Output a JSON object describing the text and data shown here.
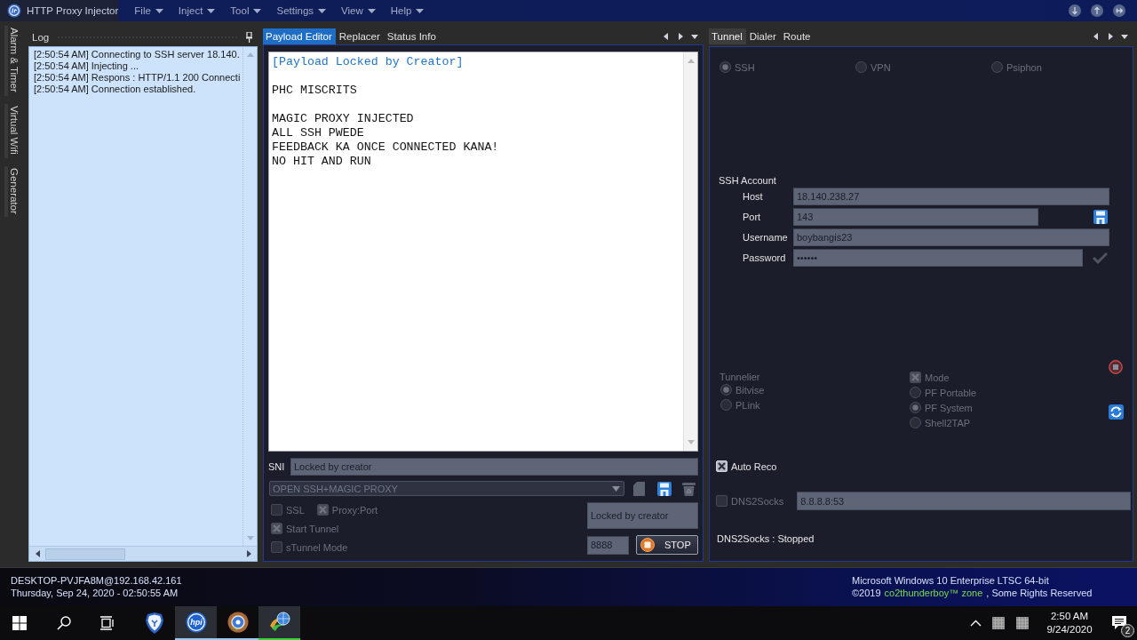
{
  "window": {
    "title": "HTTP Proxy Injector"
  },
  "menu": [
    {
      "label": "File"
    },
    {
      "label": "Inject"
    },
    {
      "label": "Tool"
    },
    {
      "label": "Settings"
    },
    {
      "label": "View"
    },
    {
      "label": "Help"
    }
  ],
  "side_tabs": [
    {
      "label": "Alarm & Timer"
    },
    {
      "label": "Virtual Wifi"
    },
    {
      "label": "Generator"
    }
  ],
  "log": {
    "title": "Log",
    "lines": [
      "[2:50:54 AM] Connecting to SSH server 18.140.",
      "[2:50:54 AM] Injecting ...",
      "[2:50:54 AM] Respons : HTTP/1.1 200 Connecti",
      "[2:50:54 AM] Connection established."
    ]
  },
  "payload_panel": {
    "tabs": [
      {
        "label": "Payload Editor",
        "selected": true
      },
      {
        "label": "Replacer",
        "selected": false
      },
      {
        "label": "Status Info",
        "selected": false
      }
    ],
    "editor": {
      "paragraphs": [
        {
          "kind": "notice",
          "lines": [
            "[Payload Locked by Creator]"
          ]
        },
        {
          "kind": "plain",
          "lines": [
            "PHC MISCRITS"
          ]
        },
        {
          "kind": "plain",
          "lines": [
            "MAGIC PROXY INJECTED",
            "ALL SSH PWEDE",
            "FEEDBACK KA ONCE CONNECTED KANA!",
            "NO HIT AND RUN"
          ]
        }
      ]
    },
    "sni": {
      "label": "SNI",
      "value": "Locked by creator"
    },
    "profile": {
      "value": "OPEN SSH+MAGIC PROXY",
      "disabled": true
    },
    "option_rows": [
      [
        {
          "label": "SSL",
          "checked": false,
          "disabled": true
        },
        {
          "label": "Proxy:Port",
          "checked": true,
          "disabled": true
        }
      ],
      [
        {
          "label": "Start Tunnel",
          "checked": true,
          "disabled": true
        }
      ],
      [
        {
          "label": "sTunnel Mode",
          "checked": false,
          "disabled": true
        }
      ]
    ],
    "proxy": {
      "value": "Locked by creator"
    },
    "port": {
      "value": "8888"
    },
    "stop_button": {
      "label": "STOP"
    }
  },
  "tunnel_panel": {
    "tabs": [
      {
        "label": "Tunnel",
        "selected": true
      },
      {
        "label": "Dialer",
        "selected": false
      },
      {
        "label": "Route",
        "selected": false
      }
    ],
    "protocols": [
      {
        "label": "SSH",
        "selected": true,
        "disabled": true
      },
      {
        "label": "VPN",
        "selected": false,
        "disabled": true
      },
      {
        "label": "Psiphon",
        "selected": false,
        "disabled": true
      }
    ],
    "ssh_account": {
      "title": "SSH Account",
      "fields": [
        {
          "kind": "text",
          "label": "Host",
          "value": "18.140.238.27"
        },
        {
          "kind": "port",
          "label": "Port",
          "value": "143"
        },
        {
          "kind": "text",
          "label": "Username",
          "value": "boybangis23"
        },
        {
          "kind": "password",
          "label": "Password",
          "value": "••••••"
        }
      ]
    },
    "tunnelier": {
      "title": "Tunnelier",
      "disabled": true,
      "options": [
        {
          "label": "Bitvise",
          "selected": true,
          "disabled": true
        },
        {
          "label": "PLink",
          "selected": false,
          "disabled": true
        }
      ]
    },
    "mode": {
      "label": "Mode",
      "checked": true,
      "disabled": true,
      "options": [
        {
          "label": "PF Portable",
          "selected": false,
          "disabled": true
        },
        {
          "label": "PF System",
          "selected": true,
          "disabled": true
        },
        {
          "label": "Shell2TAP",
          "selected": false,
          "disabled": true
        }
      ]
    },
    "auto_reco": {
      "label": "Auto Reco",
      "checked": true,
      "disabled": false
    },
    "dns2socks": {
      "label": "DNS2Socks",
      "checked": false,
      "disabled": true,
      "value": "8.8.8.8:53"
    },
    "dns_status": "DNS2Socks : Stopped"
  },
  "status_strip": {
    "host": "DESKTOP-PVJFA8M@192.168.42.161",
    "datetime": "Thursday, Sep 24, 2020 - 02:50:55 AM",
    "os": "Microsoft Windows 10 Enterprise LTSC 64-bit",
    "copyright": "©2019",
    "brand": "co2thunderboy™ zone",
    "rights": ", Some Rights Reserved"
  },
  "taskbar": {
    "apps": [
      {
        "kind": "shield",
        "selected": false,
        "running": false
      },
      {
        "kind": "hpi",
        "logo_text": "hpi",
        "selected": true,
        "running": true,
        "color": "#99c9ef"
      },
      {
        "kind": "round",
        "selected": false,
        "running": true,
        "color": "#99c9ef"
      },
      {
        "kind": "globe",
        "selected": true,
        "running": true,
        "color": "#35d435"
      }
    ],
    "clock": {
      "time": "2:50 AM",
      "date": "9/24/2020"
    },
    "notifications": "2"
  }
}
